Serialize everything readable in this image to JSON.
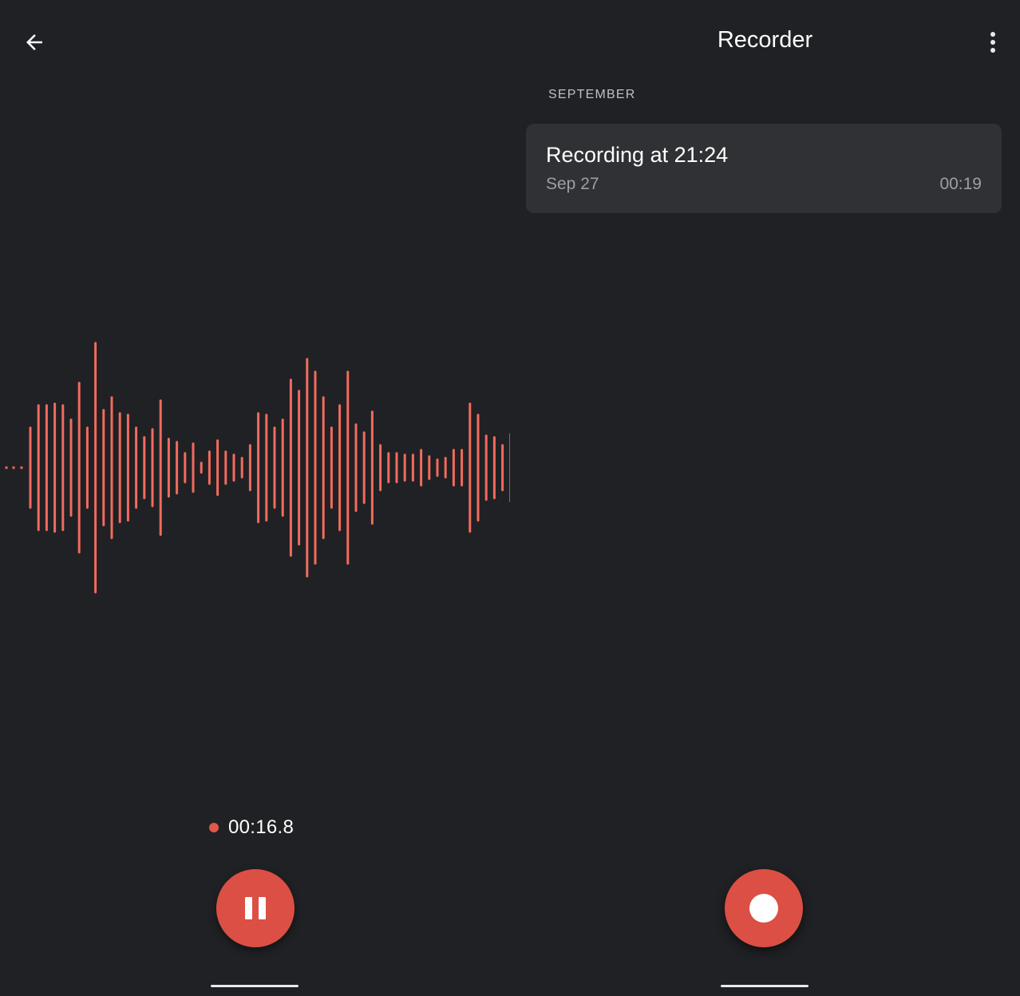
{
  "recording_view": {
    "timer": "00:16.8",
    "back_icon": "arrow-left-icon",
    "pause_icon": "pause-icon",
    "waveform_color": "#f26b5e",
    "accent_color": "#db4f44"
  },
  "app": {
    "title": "Recorder",
    "menu_icon": "more-vert-icon"
  },
  "recordings_list": {
    "sections": [
      {
        "header": "SEPTEMBER",
        "items": [
          {
            "title": "Recording at 21:24",
            "date": "Sep 27",
            "duration": "00:19"
          }
        ]
      }
    ]
  },
  "record_icon": "record-icon"
}
